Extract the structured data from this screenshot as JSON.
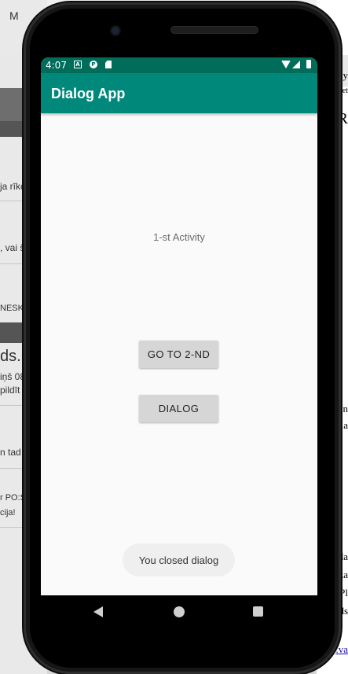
{
  "background": {
    "left_fragments": [
      "M",
      "ja rīkc",
      ", vai š",
      "NESK",
      "ds.lv",
      "iņš 08",
      "pildīt",
      "n tad",
      "r PO:S",
      "cija!"
    ],
    "right_fragments": [
      "ly",
      "et",
      "R",
      "n",
      "dla",
      "nda",
      "za",
      ",Pl",
      "nds",
      ".va"
    ]
  },
  "status_bar": {
    "time": "4:07",
    "icons": [
      "a-notification-icon",
      "p-notification-icon",
      "sd-card-icon",
      "wifi-icon",
      "signal-icon",
      "battery-icon"
    ]
  },
  "app_bar": {
    "title": "Dialog App"
  },
  "content": {
    "activity_label": "1-st Activity"
  },
  "buttons": {
    "go_to_second": "GO TO 2-ND",
    "dialog": "DIALOG"
  },
  "toast": {
    "message": "You closed dialog"
  },
  "colors": {
    "primary": "#00897b",
    "status_bar": "#006c5a",
    "button_bg": "#d6d6d6",
    "screen_bg": "#fafafa"
  }
}
